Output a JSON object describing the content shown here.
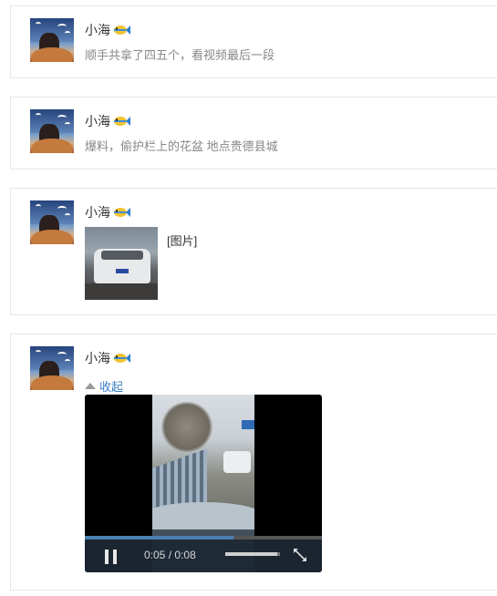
{
  "posts": [
    {
      "author": "小海",
      "text": "顺手共拿了四五个，看视频最后一段"
    },
    {
      "author": "小海",
      "text": "爆料，偷护栏上的花盆 地点贵德县城"
    },
    {
      "author": "小海",
      "image_label": "[图片]"
    },
    {
      "author": "小海",
      "collapse_label": "收起",
      "video": {
        "current_time": "0:05",
        "separator": "/",
        "duration": "0:08",
        "progress_fraction": 0.625,
        "volume_fraction": 0.95
      }
    }
  ],
  "colors": {
    "link": "#3b7dc4",
    "muted_text": "#888888",
    "progress": "#4a7fb0"
  }
}
